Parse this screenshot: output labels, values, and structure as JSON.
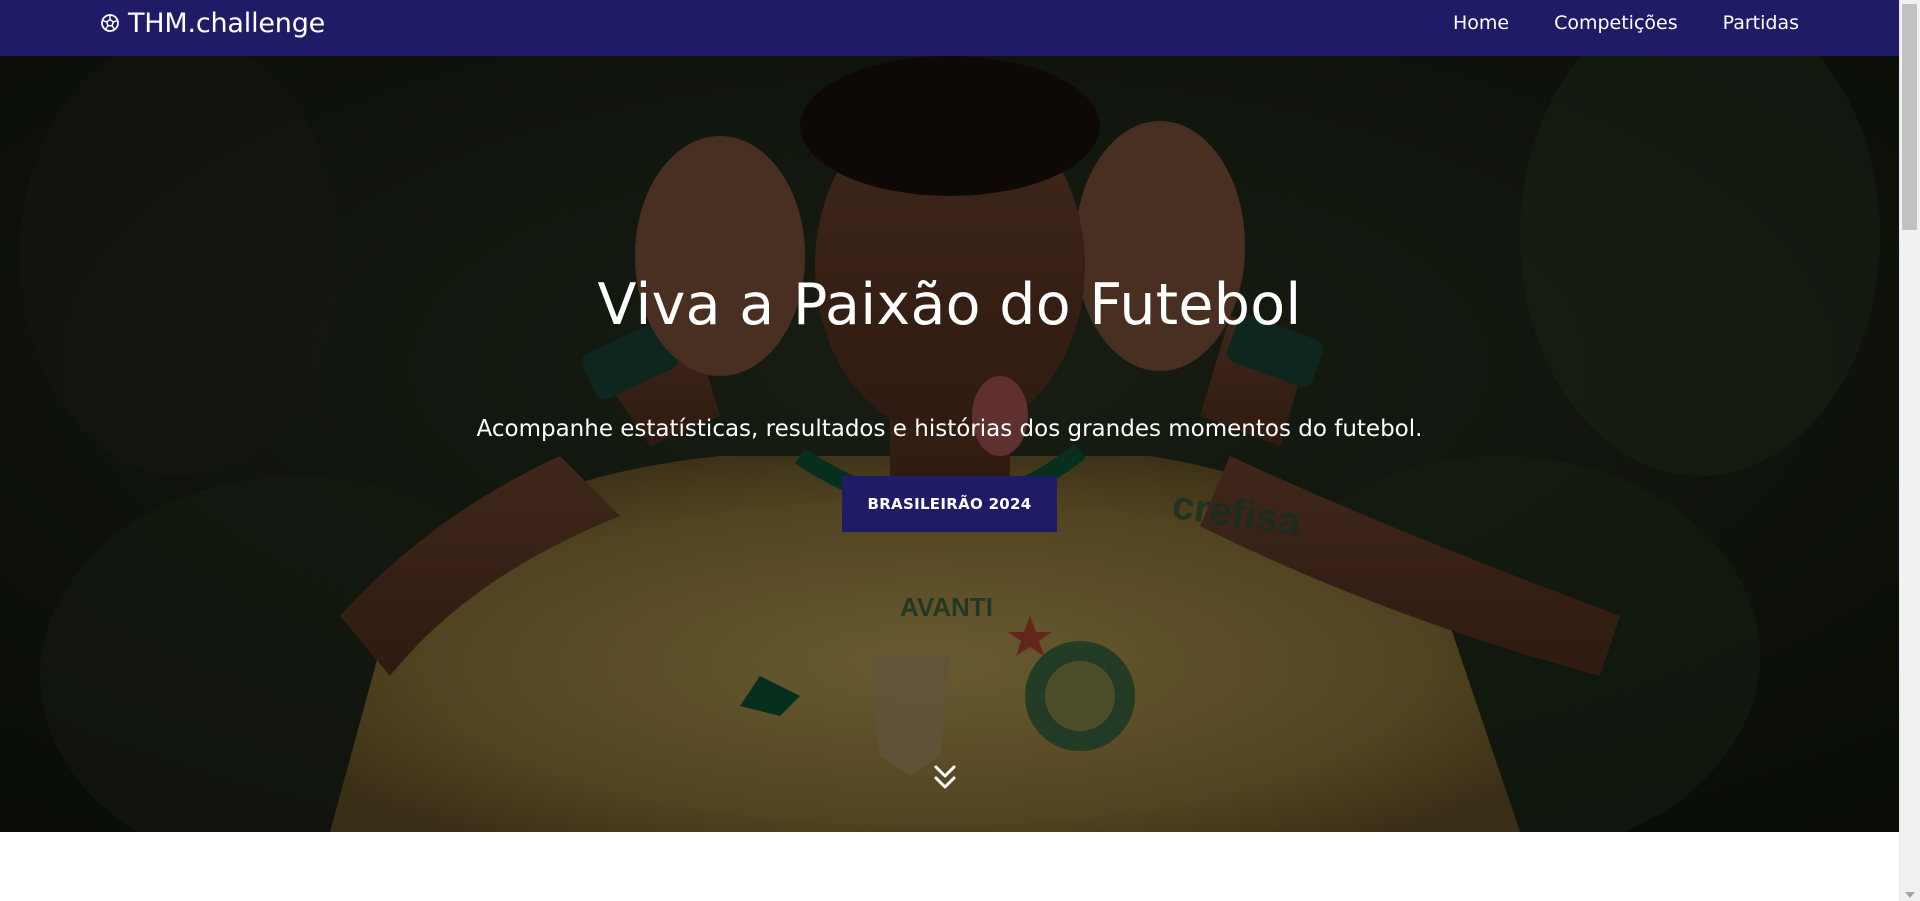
{
  "navbar": {
    "brand": "THM.challenge",
    "brand_icon": "soccer-ball-icon",
    "links": [
      "Home",
      "Competições",
      "Partidas"
    ],
    "background": "#201b67"
  },
  "hero": {
    "title": "Viva a Paixão do Futebol",
    "subtitle": "Acompanhe estatísticas, resultados e histórias dos grandes momentos do futebol.",
    "button_label": "BRASILEIRÃO 2024",
    "scroll_icon": "chevron-double-down-icon"
  },
  "colors": {
    "accent": "#201b67",
    "text_light": "#ffffff",
    "jersey": "#b49a4e",
    "trim": "#0f5a3a"
  }
}
